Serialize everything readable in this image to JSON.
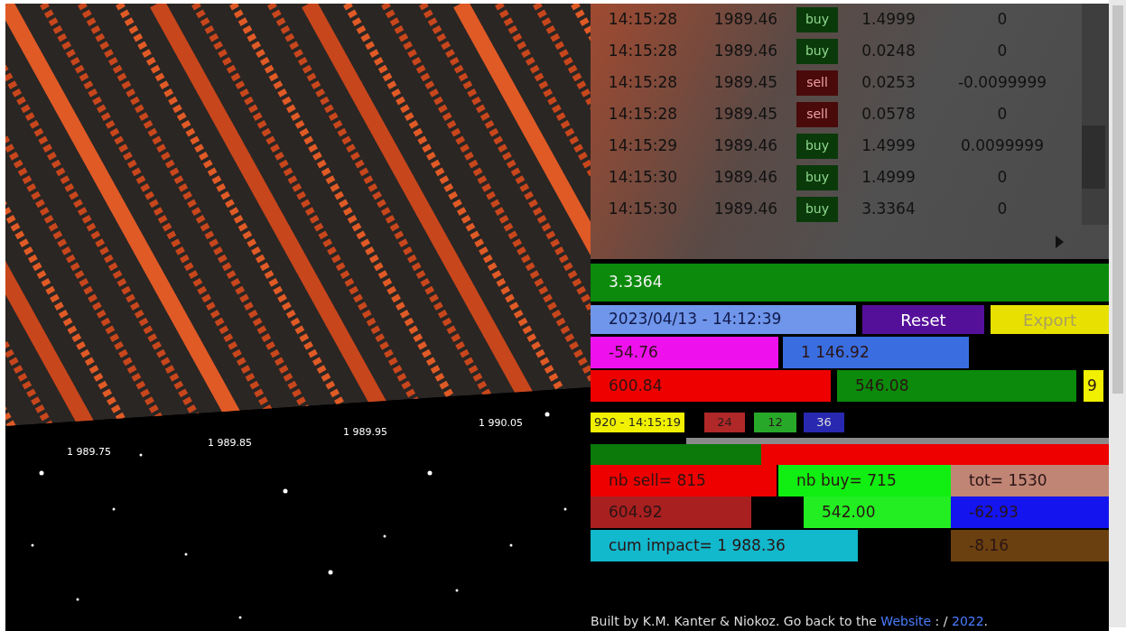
{
  "trades": [
    {
      "time": "14:15:28",
      "price": "1989.46",
      "side": "buy",
      "kind": "buy",
      "amount": "1.4999",
      "impact": "0"
    },
    {
      "time": "14:15:28",
      "price": "1989.46",
      "side": "buy",
      "kind": "buy",
      "amount": "0.0248",
      "impact": "0"
    },
    {
      "time": "14:15:28",
      "price": "1989.45",
      "side": "sell",
      "kind": "sell",
      "amount": "0.0253",
      "impact": "-0.0099999"
    },
    {
      "time": "14:15:28",
      "price": "1989.45",
      "side": "sell",
      "kind": "sell",
      "amount": "0.0578",
      "impact": "0"
    },
    {
      "time": "14:15:29",
      "price": "1989.46",
      "side": "buy",
      "kind": "buy",
      "amount": "1.4999",
      "impact": "0.0099999"
    },
    {
      "time": "14:15:30",
      "price": "1989.46",
      "side": "buy",
      "kind": "buy",
      "amount": "1.4999",
      "impact": "0"
    },
    {
      "time": "14:15:30",
      "price": "1989.46",
      "side": "buy",
      "kind": "buy",
      "amount": "3.3364",
      "impact": "0"
    }
  ],
  "axis_labels": [
    "1 989.75",
    "1 989.85",
    "1 989.95",
    "1 990.05"
  ],
  "current_amount": {
    "value": "3.3364",
    "color": "#0b8a0b"
  },
  "date_field": {
    "value": "2023/04/13 - 14:12:39"
  },
  "buttons": [
    {
      "label": "Reset",
      "disabled": false
    },
    {
      "label": "Export",
      "disabled": true
    }
  ],
  "price_rows": [
    [
      {
        "value": "-54.76",
        "color": "#ee11ee"
      },
      {
        "value": "1 146.92",
        "color": "#3a6ee0"
      }
    ],
    [
      {
        "value": "600.84",
        "color": "#ee0000"
      },
      {
        "value": "546.08",
        "color": "#0b8a0b"
      },
      {
        "value": "9",
        "color": "#f0f000"
      }
    ]
  ],
  "counters": [
    {
      "value": "920 - 14:15:19",
      "color": "#f0f000"
    },
    {
      "value": "24",
      "color": "#b02828"
    },
    {
      "value": "12",
      "color": "#28a828"
    },
    {
      "value": "36",
      "color": "#2828b0"
    }
  ],
  "balance_bar": {
    "level": 0.33
  },
  "summary_rows": [
    [
      {
        "value": "nb sell= 815",
        "color": "#ee0000"
      },
      {
        "value": "nb buy= 715",
        "color": "#11ee11"
      },
      {
        "value": "tot= 1530",
        "color": "#c08575"
      }
    ],
    [
      {
        "value": "604.92",
        "color": "#a82020"
      },
      {
        "value": "542.00",
        "color": "#22ee22"
      },
      {
        "value": "-62.93",
        "color": "#1414ee"
      }
    ],
    [
      {
        "value": "cum impact= 1 988.36",
        "color": "#12b8cc"
      },
      {
        "value": "-8.16",
        "color": "#6b4010"
      }
    ]
  ],
  "footer": {
    "before": "Built by K.M. Kanter & Niokoz. Go back to the",
    "link_1": "Website",
    "middle": ": /",
    "link_2": "2022",
    "after": "."
  }
}
